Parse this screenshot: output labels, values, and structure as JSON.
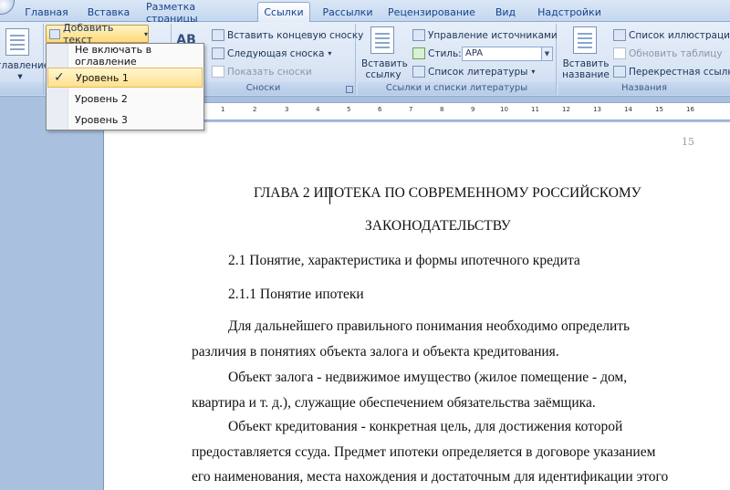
{
  "tabs": [
    "Главная",
    "Вставка",
    "Разметка страницы",
    "Ссылки",
    "Рассылки",
    "Рецензирование",
    "Вид",
    "Надстройки"
  ],
  "active_tab": "Ссылки",
  "ribbon": {
    "toc_partial_label": "главление",
    "toc_arrow": "▾",
    "add_text": "Добавить текст",
    "footnote_big_label": "AB",
    "footnotes": {
      "insert_endnote": "Вставить концевую сноску",
      "next_footnote": "Следующая сноска",
      "show_notes": "Показать сноски",
      "group_title": "Сноски"
    },
    "citations": {
      "insert_citation": "Вставить ссылку",
      "manage_sources": "Управление источниками",
      "style_label": "Стиль:",
      "style_value": "APA",
      "bibliography": "Список литературы",
      "group_title": "Ссылки и списки литературы"
    },
    "captions": {
      "insert_caption": "Вставить название",
      "table_of_figures": "Список иллюстраций",
      "update_table": "Обновить таблицу",
      "cross_reference": "Перекрестная ссылка",
      "group_title": "Названия"
    }
  },
  "dropdown": {
    "items": [
      "Не включать в оглавление",
      "Уровень 1",
      "Уровень 2",
      "Уровень 3"
    ],
    "selected": "Уровень 1",
    "check": "✓"
  },
  "ruler_ticks": [
    "1",
    "2",
    "3",
    "4",
    "5",
    "6",
    "7",
    "8",
    "9",
    "10",
    "11",
    "12",
    "13",
    "14",
    "15",
    "16"
  ],
  "document": {
    "page_number": "15",
    "heading_line1": "ГЛАВА 2 ИПОТЕКА ПО СОВРЕМЕННОМУ РОССИЙСКОМУ",
    "heading_line2": "ЗАКОНОДАТЕЛЬСТВУ",
    "section": "2.1 Понятие, характеристика и формы ипотечного кредита",
    "subsection": "2.1.1 Понятие ипотеки",
    "para1_line1": "Для дальнейшего правильного понимания необходимо определить",
    "para1_line2": "различия в понятиях объекта залога и объекта кредитования.",
    "para2_line1": "Объект залога - недвижимое имущество (жилое помещение - дом,",
    "para2_line2": "квартира и т. д.), служащие обеспечением обязательства заёмщика.",
    "para3_line1": "Объект кредитования - конкретная цель, для достижения которой",
    "para3_line2": "предоставляется ссуда. Предмет ипотеки определяется в договоре указанием",
    "para3_line3": "его наименования, места нахождения и достаточным для идентификации этого"
  }
}
